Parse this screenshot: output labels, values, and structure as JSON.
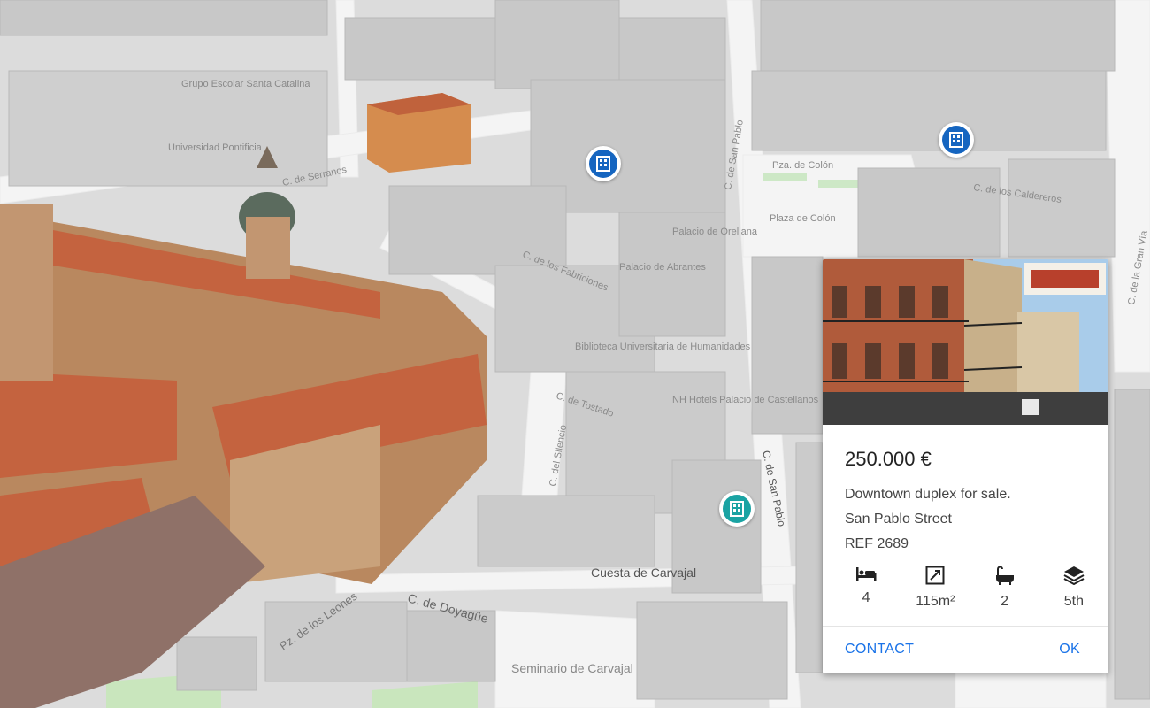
{
  "map": {
    "street_labels": [
      "Grupo Escolar Santa Catalina",
      "Universidad Pontificia",
      "C. de Serranos",
      "Pza. de Colón",
      "C. de San Pablo",
      "C. de los Caldereros",
      "Plaza de Colón",
      "C. de los Fabriciones",
      "Palacio de Abrantes",
      "Palacio de Orellana",
      "Biblioteca Universitaria de Humanidades",
      "C. de Tostado",
      "C. del Silencio",
      "NH Hotels Palacio de Castellanos",
      "C. de San Pablo",
      "C. de la Gran Vía",
      "Cuesta de Carvajal",
      "Pz. de los Leones",
      "C. de Doyagüe",
      "Seminario de Carvajal"
    ]
  },
  "pins": [
    {
      "icon": "building-icon",
      "color": "#1565c0"
    },
    {
      "icon": "building-icon",
      "color": "#1565c0"
    },
    {
      "icon": "building-icon",
      "color": "#1aa3a3"
    }
  ],
  "listing": {
    "price": "250.000 €",
    "description_line1": "Downtown duplex for sale.",
    "description_line2": "San Pablo Street",
    "reference": "REF 2689",
    "features": [
      {
        "icon": "bed-icon",
        "value": "4"
      },
      {
        "icon": "area-icon",
        "value": "115m²"
      },
      {
        "icon": "bathtub-icon",
        "value": "2"
      },
      {
        "icon": "floors-icon",
        "value": "5th"
      }
    ],
    "contact_label": "CONTACT",
    "ok_label": "OK"
  }
}
